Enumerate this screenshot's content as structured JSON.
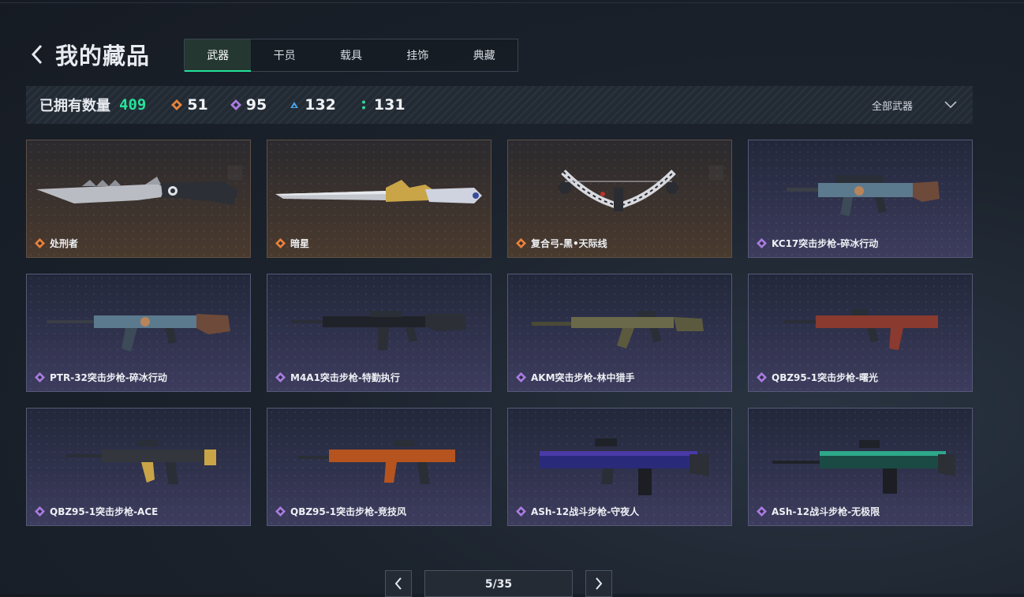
{
  "header": {
    "title": "我的藏品"
  },
  "tabs": [
    {
      "label": "武器",
      "active": true
    },
    {
      "label": "干员",
      "active": false
    },
    {
      "label": "载具",
      "active": false
    },
    {
      "label": "挂饰",
      "active": false
    },
    {
      "label": "典藏",
      "active": false
    }
  ],
  "stats": {
    "owned_label": "已拥有数量",
    "owned_count": "409",
    "rarities": [
      {
        "icon": "orange-diamond-icon",
        "color": "#e8823a",
        "count": "51"
      },
      {
        "icon": "purple-diamond-icon",
        "color": "#a97be0",
        "count": "95"
      },
      {
        "icon": "blue-triangle-icon",
        "color": "#4aa3e8",
        "count": "132"
      },
      {
        "icon": "green-dots-icon",
        "color": "#2ed69a",
        "count": "131"
      }
    ]
  },
  "filter": {
    "label": "全部武器"
  },
  "items": [
    {
      "name": "处刑者",
      "rarity": "orange"
    },
    {
      "name": "暗星",
      "rarity": "orange"
    },
    {
      "name": "复合弓-黑•天际线",
      "rarity": "orange"
    },
    {
      "name": "KC17突击步枪-碎冰行动",
      "rarity": "purple"
    },
    {
      "name": "PTR-32突击步枪-碎冰行动",
      "rarity": "purple"
    },
    {
      "name": "M4A1突击步枪-特勤执行",
      "rarity": "purple"
    },
    {
      "name": "AKM突击步枪-林中猎手",
      "rarity": "purple"
    },
    {
      "name": "QBZ95-1突击步枪-曙光",
      "rarity": "purple"
    },
    {
      "name": "QBZ95-1突击步枪-ACE",
      "rarity": "purple"
    },
    {
      "name": "QBZ95-1突击步枪-竞技风",
      "rarity": "purple"
    },
    {
      "name": "ASh-12战斗步枪-守夜人",
      "rarity": "purple"
    },
    {
      "name": "ASh-12战斗步枪-无极限",
      "rarity": "purple"
    }
  ],
  "pagination": {
    "text": "5/35"
  },
  "colors": {
    "accent": "#21e29a",
    "orange": "#e8823a",
    "purple": "#a97be0"
  }
}
